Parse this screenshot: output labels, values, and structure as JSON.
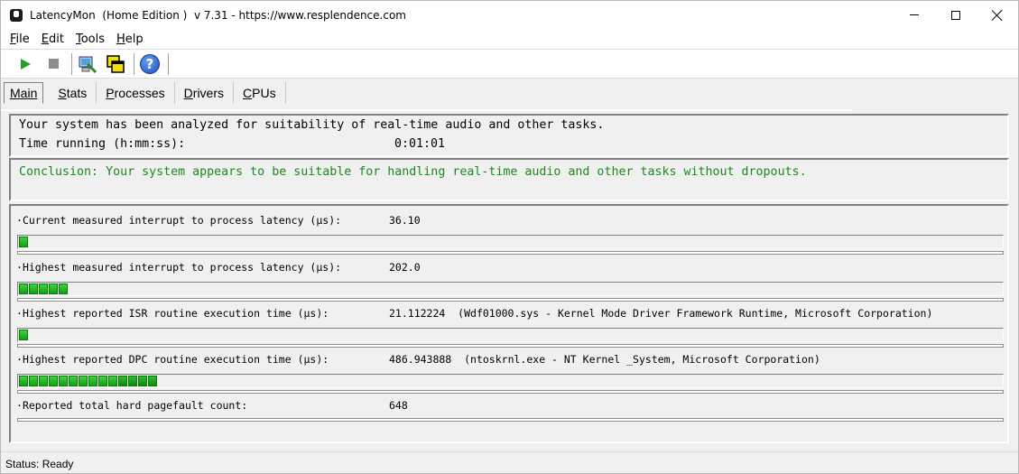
{
  "window": {
    "title": "LatencyMon  (Home Edition )  v 7.31 - https://www.resplendence.com"
  },
  "menu": {
    "items": [
      {
        "first": "F",
        "rest": "ile"
      },
      {
        "first": "E",
        "rest": "dit"
      },
      {
        "first": "T",
        "rest": "ools"
      },
      {
        "first": "H",
        "rest": "elp"
      }
    ]
  },
  "toolbar": {
    "buttons": [
      "play-icon",
      "stop-icon",
      "cleanup-icon",
      "windows-icon",
      "help-icon"
    ],
    "help_glyph": "?"
  },
  "tabs": [
    {
      "first": "M",
      "rest": "ain",
      "active": true
    },
    {
      "first": "S",
      "rest": "tats",
      "active": false
    },
    {
      "first": "P",
      "rest": "rocesses",
      "active": false
    },
    {
      "first": "D",
      "rest": "rivers",
      "active": false
    },
    {
      "first": "C",
      "rest": "PUs",
      "active": false
    }
  ],
  "summary": {
    "line1": "Your system has been analyzed for suitability of real-time audio and other tasks.",
    "line2_label": "Time running (h:mm:ss):",
    "line2_value": "0:01:01"
  },
  "conclusion": {
    "text": "Conclusion: Your system appears to be suitable for handling real-time audio and other tasks without dropouts.",
    "color": "#1b8a1b"
  },
  "metrics": [
    {
      "label": "Current measured interrupt to process latency (µs):",
      "value": "36.10",
      "detail": "",
      "segments": 1
    },
    {
      "label": "Highest measured interrupt to process latency (µs):",
      "value": "202.0",
      "detail": "",
      "segments": 5
    },
    {
      "label": "Highest reported ISR routine execution time (µs):",
      "value": "21.112224",
      "detail": "(Wdf01000.sys - Kernel Mode Driver Framework Runtime, Microsoft Corporation)",
      "segments": 1
    },
    {
      "label": "Highest reported DPC routine execution time (µs):",
      "value": "486.943888",
      "detail": "(ntoskrnl.exe - NT Kernel _System, Microsoft Corporation)",
      "segments": 14
    },
    {
      "label": "Reported total hard pagefault count:",
      "value": "648",
      "detail": "",
      "segments": 0
    }
  ],
  "status": {
    "text": "Status: Ready"
  },
  "colors": {
    "bar_green": "#22c022",
    "help_blue": "#1a4fbf"
  }
}
